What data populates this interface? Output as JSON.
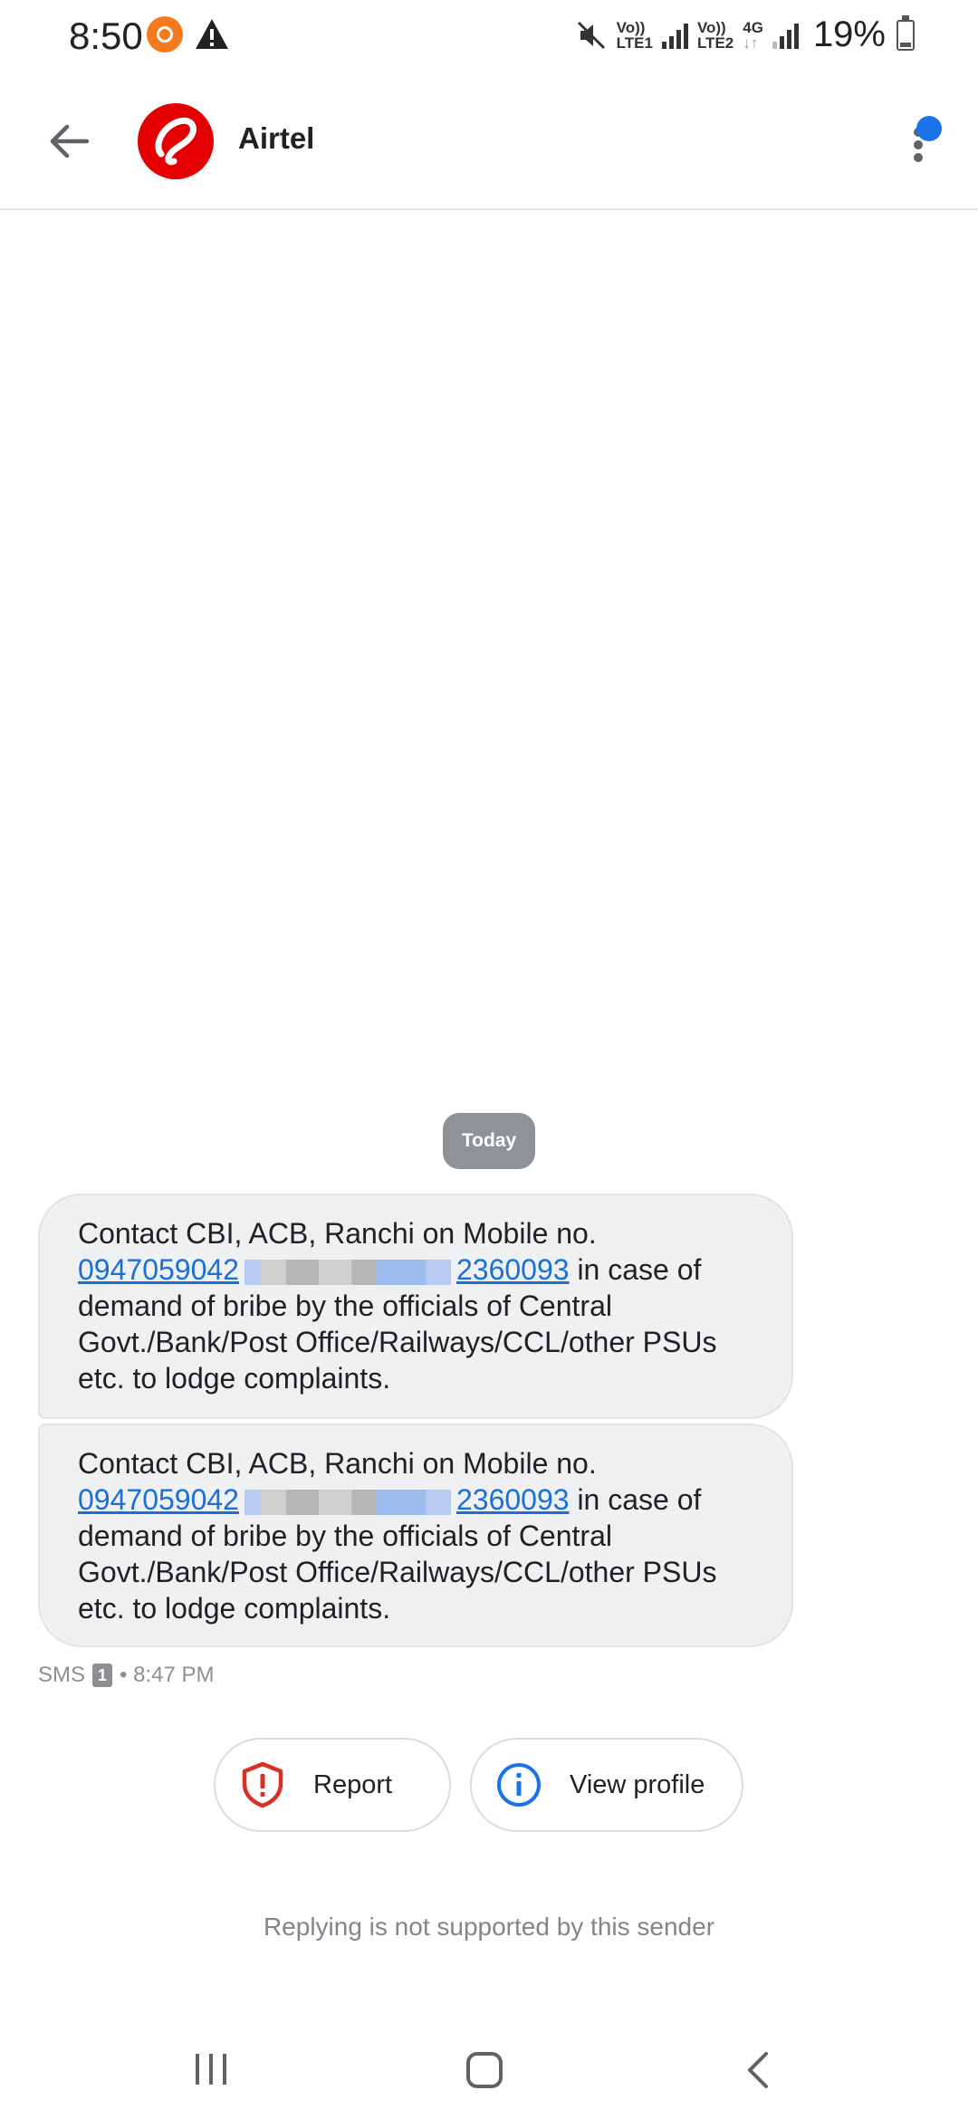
{
  "status_bar": {
    "time": "8:50",
    "left_icons": [
      "screen-recorder-icon",
      "warning-icon"
    ],
    "right_icons": [
      "mute-icon",
      "signal-icon",
      "signal-icon",
      "battery-icon"
    ],
    "sim1_tag_line1": "Vo))",
    "sim1_tag_line2": "LTE1",
    "sim2_tag_line1": "Vo))",
    "sim2_tag_line2": "LTE2",
    "network_type": "4G",
    "battery_percent": "19%",
    "battery_level": 0.19
  },
  "app_bar": {
    "contact_name": "Airtel",
    "back_icon": "arrow-back-icon",
    "avatar_icon": "airtel-logo",
    "more_icon": "more-vert-icon",
    "accent_color": "#1a73e8"
  },
  "conversation": {
    "date_chip": "Today",
    "messages": [
      {
        "text_before": "Contact CBI, ACB, Ranchi on Mobile no.",
        "phone_1": "0947059042",
        "phone_2": "2360093",
        "text_after": "in case of demand of bribe by the officials of Central Govt./Bank/Post Office/Railways/CCL/other PSUs etc. to lodge complaints."
      },
      {
        "text_before": "Contact CBI, ACB, Ranchi on Mobile no.",
        "phone_1": "0947059042",
        "phone_2": "2360093",
        "text_after": "in case of demand of bribe by the officials of Central Govt./Bank/Post Office/Railways/CCL/other PSUs etc. to lodge complaints."
      }
    ],
    "meta": {
      "type": "SMS",
      "sim": "1",
      "time": "• 8:47 PM"
    }
  },
  "actions": {
    "report_label": "Report",
    "report_color": "#d93025",
    "view_profile_label": "View profile",
    "view_profile_color": "#1a73e8"
  },
  "footer": {
    "reply_note": "Replying is not supported by this sender"
  },
  "nav_bar": {
    "icons": [
      "recent-apps-icon",
      "home-icon",
      "back-icon"
    ]
  }
}
